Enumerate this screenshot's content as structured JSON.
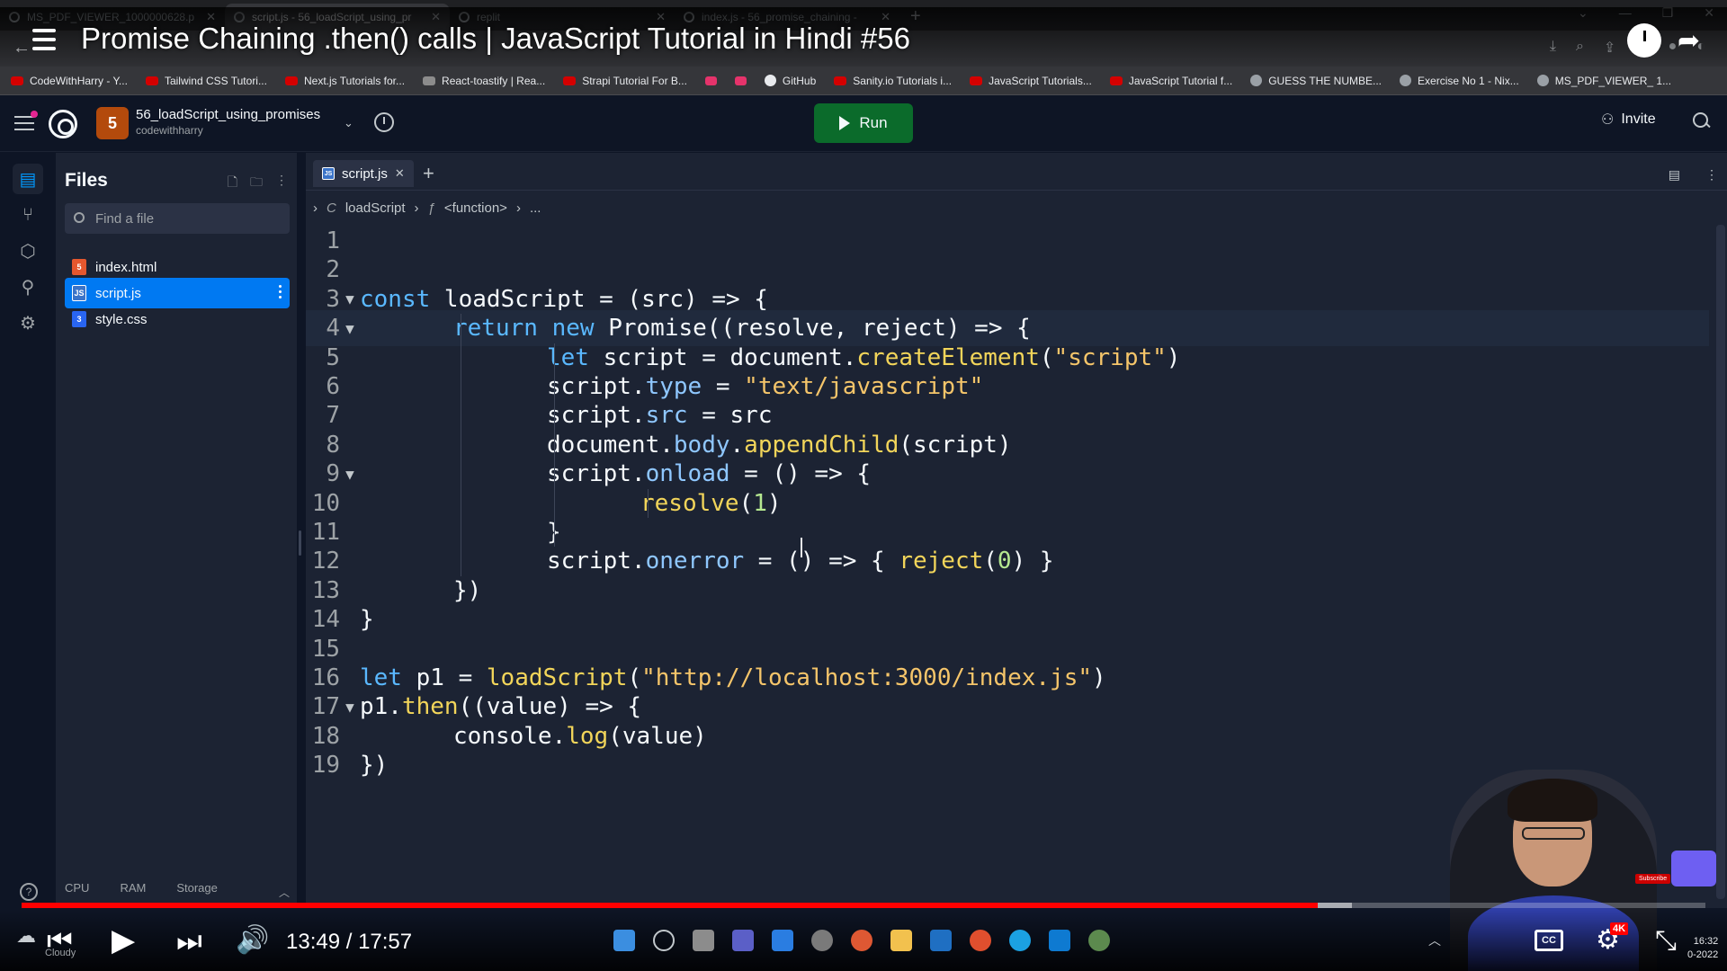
{
  "browser": {
    "tabs": [
      {
        "label": "MS_PDF_VIEWER_1000000628.p",
        "active": false
      },
      {
        "label": "script.js - 56_loadScript_using_pr",
        "active": true
      },
      {
        "label": "replit",
        "active": false
      },
      {
        "label": "index.js - 56_promise_chaining -",
        "active": false
      }
    ],
    "bookmarks": [
      {
        "label": "CodeWithHarry - Y...",
        "icon": "youtube-icon"
      },
      {
        "label": "Tailwind CSS Tutori...",
        "icon": "youtube-icon"
      },
      {
        "label": "Next.js Tutorials for...",
        "icon": "youtube-icon"
      },
      {
        "label": "React-toastify | Rea...",
        "icon": "link-icon"
      },
      {
        "label": "Strapi Tutorial For B...",
        "icon": "youtube-icon"
      },
      {
        "label": "",
        "icon": "pink-logo-icon"
      },
      {
        "label": "",
        "icon": "pink-logo-icon"
      },
      {
        "label": "GitHub",
        "icon": "github-icon"
      },
      {
        "label": "Sanity.io Tutorials i...",
        "icon": "youtube-icon"
      },
      {
        "label": "JavaScript Tutorials...",
        "icon": "youtube-icon"
      },
      {
        "label": "JavaScript Tutorial f...",
        "icon": "youtube-icon"
      },
      {
        "label": "GUESS THE NUMBE...",
        "icon": "replit-icon"
      },
      {
        "label": "Exercise No 1 - Nix...",
        "icon": "replit-icon"
      },
      {
        "label": "MS_PDF_VIEWER_ 1...",
        "icon": "globe-icon"
      }
    ]
  },
  "video": {
    "title": "Promise Chaining .then() calls | JavaScript Tutorial in Hindi #56",
    "time": "13:49 / 17:57",
    "played_fraction": 0.77,
    "buffered_fraction": 0.79,
    "badge": "4K",
    "cc": "CC",
    "subscribe": "Subscribe",
    "weather": "Cloudy",
    "clock_time": "16:32",
    "clock_date": "0-2022"
  },
  "replit": {
    "repl_name": "56_loadScript_using_promises",
    "owner": "codewithharry",
    "run_label": "Run",
    "invite_label": "Invite",
    "files_title": "Files",
    "find_placeholder": "Find a file",
    "files": [
      {
        "name": "index.html",
        "type": "html",
        "selected": false
      },
      {
        "name": "script.js",
        "type": "js",
        "selected": true
      },
      {
        "name": "style.css",
        "type": "css",
        "selected": false
      }
    ],
    "resources": [
      "CPU",
      "RAM",
      "Storage"
    ],
    "help_label": "?",
    "active_tab": "script.js",
    "breadcrumbs": {
      "function": "loadScript",
      "inner": "<function>",
      "more": "..."
    }
  },
  "code": {
    "current_line": 4,
    "lines": [
      {
        "n": "1",
        "fold": "",
        "indent": 0,
        "tokens": []
      },
      {
        "n": "2",
        "fold": "",
        "indent": 0,
        "tokens": []
      },
      {
        "n": "3",
        "fold": "▼",
        "indent": 0,
        "tokens": [
          [
            "kw",
            "const"
          ],
          [
            "t",
            " loadScript = (src) => {"
          ]
        ]
      },
      {
        "n": "4",
        "fold": "▼",
        "indent": 1,
        "tokens": [
          [
            "kw",
            "return"
          ],
          [
            "t",
            " "
          ],
          [
            "kw",
            "new"
          ],
          [
            "t",
            " Promise((resolve, reject) => {"
          ]
        ]
      },
      {
        "n": "5",
        "fold": "",
        "indent": 2,
        "tokens": [
          [
            "kw",
            "let"
          ],
          [
            "t",
            " script = document."
          ],
          [
            "fn",
            "createElement"
          ],
          [
            "t",
            "("
          ],
          [
            "str",
            "\"script\""
          ],
          [
            "t",
            ")"
          ]
        ]
      },
      {
        "n": "6",
        "fold": "",
        "indent": 2,
        "tokens": [
          [
            "t",
            "script."
          ],
          [
            "prop",
            "type"
          ],
          [
            "t",
            " = "
          ],
          [
            "str",
            "\"text/javascript\""
          ]
        ]
      },
      {
        "n": "7",
        "fold": "",
        "indent": 2,
        "tokens": [
          [
            "t",
            "script."
          ],
          [
            "prop",
            "src"
          ],
          [
            "t",
            " = src"
          ]
        ]
      },
      {
        "n": "8",
        "fold": "",
        "indent": 2,
        "tokens": [
          [
            "t",
            "document."
          ],
          [
            "prop",
            "body"
          ],
          [
            "t",
            "."
          ],
          [
            "fn",
            "appendChild"
          ],
          [
            "t",
            "(script)"
          ]
        ]
      },
      {
        "n": "9",
        "fold": "▼",
        "indent": 2,
        "tokens": [
          [
            "t",
            "script."
          ],
          [
            "prop",
            "onload"
          ],
          [
            "t",
            " = () => {"
          ]
        ]
      },
      {
        "n": "10",
        "fold": "",
        "indent": 3,
        "tokens": [
          [
            "fn",
            "resolve"
          ],
          [
            "t",
            "("
          ],
          [
            "num",
            "1"
          ],
          [
            "t",
            ")"
          ]
        ]
      },
      {
        "n": "11",
        "fold": "",
        "indent": 2,
        "tokens": [
          [
            "t",
            "}"
          ]
        ]
      },
      {
        "n": "12",
        "fold": "",
        "indent": 2,
        "tokens": [
          [
            "t",
            "script."
          ],
          [
            "prop",
            "onerror"
          ],
          [
            "t",
            " = () => { "
          ],
          [
            "fn",
            "reject"
          ],
          [
            "t",
            "("
          ],
          [
            "num",
            "0"
          ],
          [
            "t",
            ") }"
          ]
        ]
      },
      {
        "n": "13",
        "fold": "",
        "indent": 1,
        "tokens": [
          [
            "t",
            "})"
          ]
        ]
      },
      {
        "n": "14",
        "fold": "",
        "indent": 0,
        "tokens": [
          [
            "t",
            "}"
          ]
        ]
      },
      {
        "n": "15",
        "fold": "",
        "indent": 0,
        "tokens": []
      },
      {
        "n": "16",
        "fold": "",
        "indent": 0,
        "tokens": [
          [
            "kw",
            "let"
          ],
          [
            "t",
            " p1 = "
          ],
          [
            "fn",
            "loadScript"
          ],
          [
            "t",
            "("
          ],
          [
            "str",
            "\"http://localhost:3000/index.js\""
          ],
          [
            "t",
            ")"
          ]
        ]
      },
      {
        "n": "17",
        "fold": "▼",
        "indent": 0,
        "tokens": [
          [
            "t",
            "p1."
          ],
          [
            "fn",
            "then"
          ],
          [
            "t",
            "((value) => {"
          ]
        ]
      },
      {
        "n": "18",
        "fold": "",
        "indent": 1,
        "tokens": [
          [
            "t",
            "console."
          ],
          [
            "fn",
            "log"
          ],
          [
            "t",
            "(value)"
          ]
        ]
      },
      {
        "n": "19",
        "fold": "",
        "indent": 0,
        "tokens": [
          [
            "t",
            "})"
          ]
        ]
      }
    ]
  },
  "colors": {
    "run_button": "#0b6b2b",
    "selected_file": "#0079f2",
    "progress": "#ff0000",
    "keyword": "#5ab8ff",
    "function": "#f2d55a",
    "string": "#f5c56a"
  }
}
